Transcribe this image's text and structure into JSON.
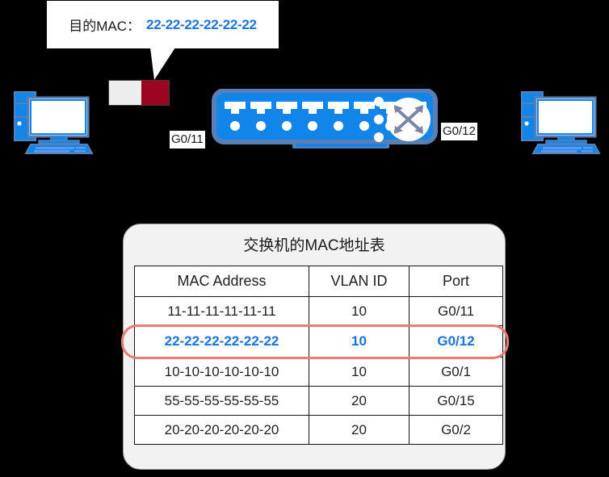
{
  "callout": {
    "label": "目的MAC：",
    "value": "22-22-22-22-22-22",
    "value_color": "#1874e0"
  },
  "topology": {
    "left_pc": "pc-icon",
    "right_pc": "pc-icon",
    "switch": "switch-icon",
    "packet": "frame-packet",
    "packet_colors": {
      "header": "#ededed",
      "payload": "#9c0420"
    },
    "device_color": "#1285eb",
    "left_port_label": "G0/11",
    "right_port_label": "G0/12"
  },
  "mac_table": {
    "title": "交换机的MAC地址表",
    "columns": [
      "MAC Address",
      "VLAN ID",
      "Port"
    ],
    "highlight_color": "#ed7b72",
    "highlight_row_index": 1,
    "rows": [
      {
        "mac": "11-11-11-11-11-11",
        "vlan": "10",
        "port": "G0/11",
        "highlight": false
      },
      {
        "mac": "22-22-22-22-22-22",
        "vlan": "10",
        "port": "G0/12",
        "highlight": true
      },
      {
        "mac": "10-10-10-10-10-10",
        "vlan": "10",
        "port": "G0/1",
        "highlight": false
      },
      {
        "mac": "55-55-55-55-55-55",
        "vlan": "20",
        "port": "G0/15",
        "highlight": false
      },
      {
        "mac": "20-20-20-20-20-20",
        "vlan": "20",
        "port": "G0/2",
        "highlight": false
      }
    ]
  }
}
